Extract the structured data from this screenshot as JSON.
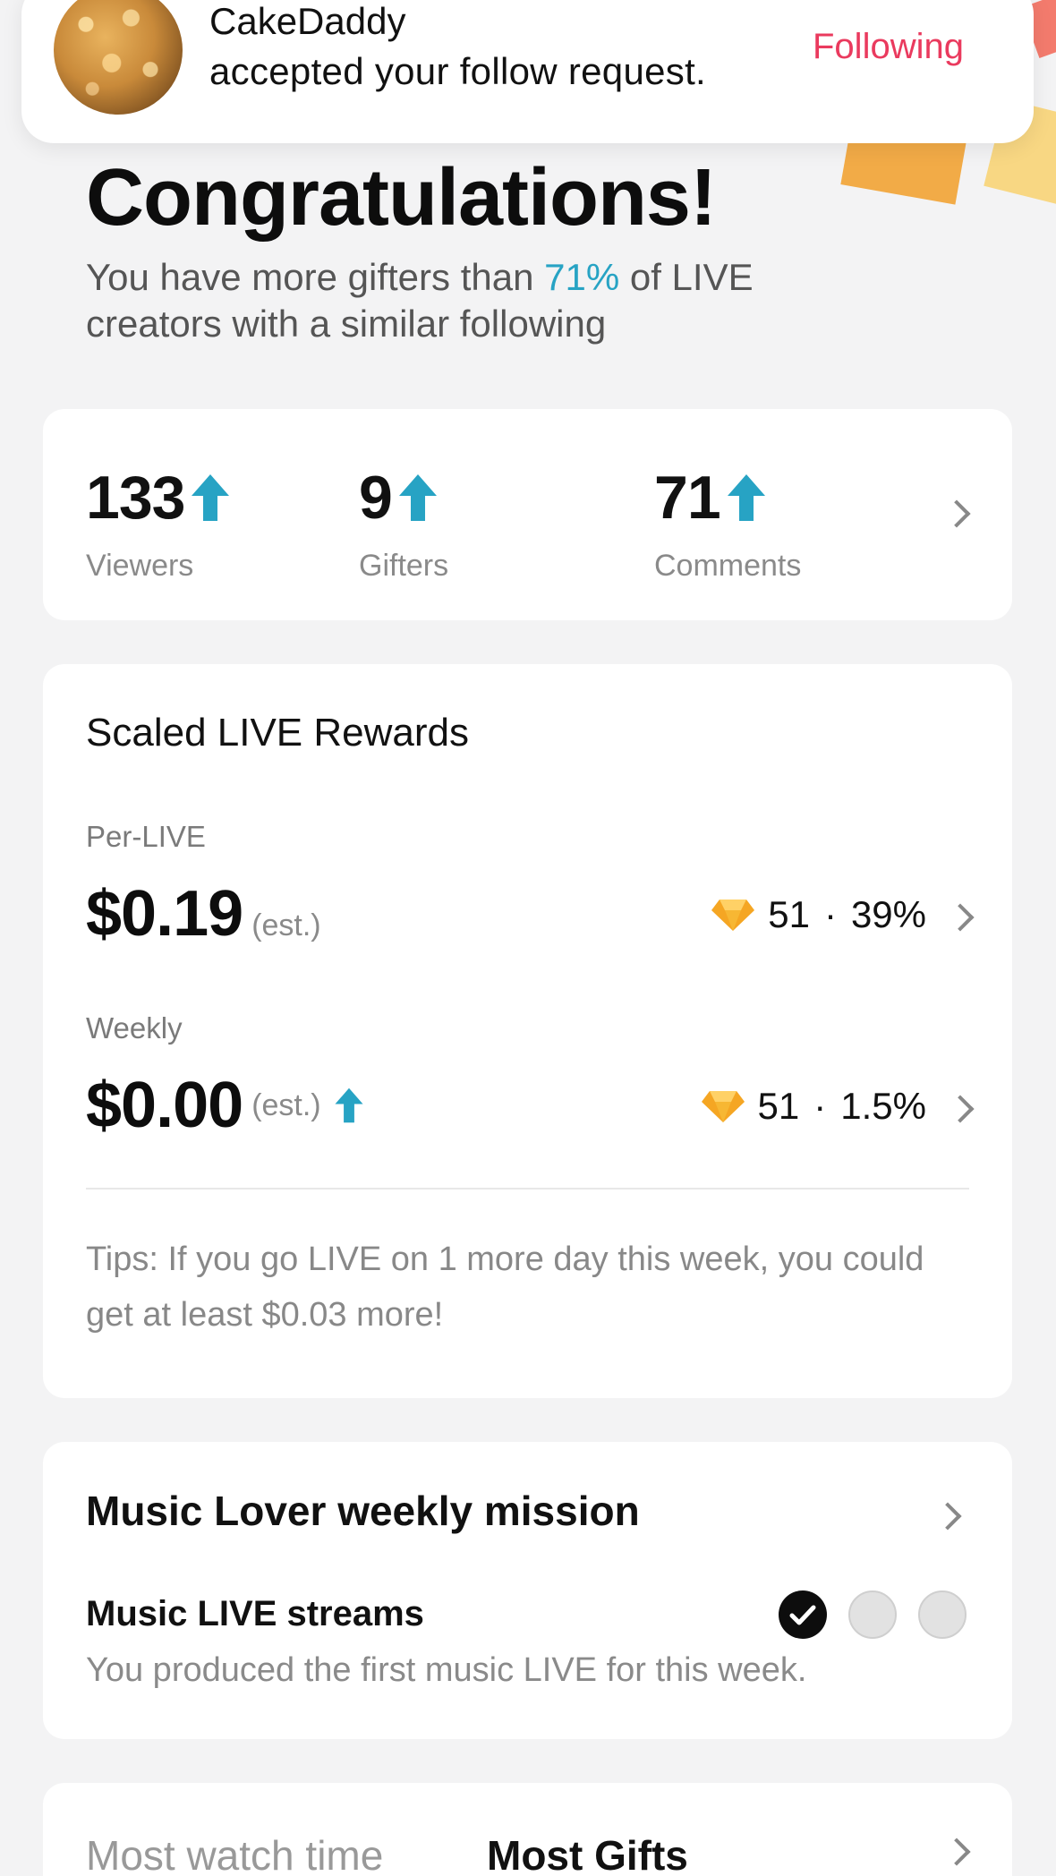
{
  "notification": {
    "name": "CakeDaddy",
    "message": "accepted your follow request.",
    "button": "Following"
  },
  "header": {
    "title": "Congratulations!",
    "subtitle_prefix": "You have more gifters than ",
    "subtitle_highlight": "71%",
    "subtitle_suffix": " of LIVE creators with a similar following"
  },
  "stats": [
    {
      "value": "133",
      "label": "Viewers"
    },
    {
      "value": "9",
      "label": "Gifters"
    },
    {
      "value": "71",
      "label": "Comments"
    }
  ],
  "rewards": {
    "title": "Scaled LIVE Rewards",
    "per_live": {
      "label": "Per-LIVE",
      "amount": "$0.19",
      "est": "(est.)",
      "gems": "51",
      "sep": "·",
      "percent": "39%"
    },
    "weekly": {
      "label": "Weekly",
      "amount": "$0.00",
      "est": "(est.)",
      "gems": "51",
      "sep": "·",
      "percent": "1.5%"
    },
    "tips": "Tips: If you go LIVE on 1 more day this week, you could get at least $0.03 more!"
  },
  "mission": {
    "title": "Music Lover weekly mission",
    "task": "Music LIVE streams",
    "description": "You produced the first music LIVE for this week.",
    "progress_done": 1,
    "progress_total": 3
  },
  "bottom_tabs": {
    "tab1": "Most watch time",
    "tab2": "Most Gifts"
  },
  "colors": {
    "accent": "#27a3c4",
    "following": "#ea3a5e",
    "gem": "#f5a623"
  }
}
